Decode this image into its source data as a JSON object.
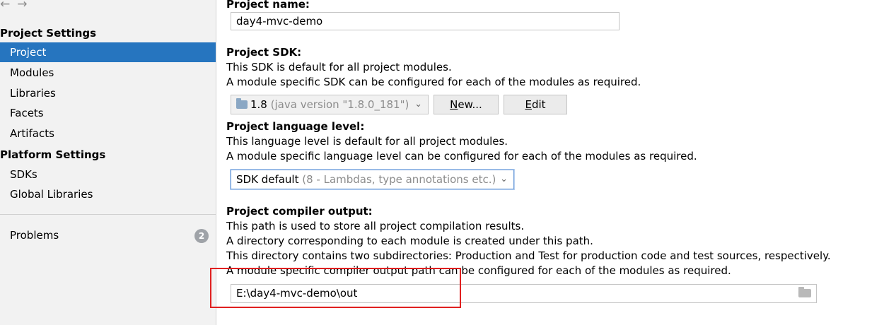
{
  "nav": {
    "back_icon": "←",
    "forward_icon": "→"
  },
  "sidebar": {
    "project_settings_header": "Project Settings",
    "project_items": [
      "Project",
      "Modules",
      "Libraries",
      "Facets",
      "Artifacts"
    ],
    "platform_settings_header": "Platform Settings",
    "platform_items": [
      "SDKs",
      "Global Libraries"
    ],
    "problems_label": "Problems",
    "problems_count": "2",
    "selected": "Project"
  },
  "main": {
    "project_name": {
      "label": "Project name:",
      "value": "day4-mvc-demo"
    },
    "project_sdk": {
      "label": "Project SDK:",
      "desc1": "This SDK is default for all project modules.",
      "desc2": "A module specific SDK can be configured for each of the modules as required.",
      "selected_version": "1.8",
      "selected_detail": "(java version \"1.8.0_181\")",
      "new_button": "New...",
      "edit_button": "Edit"
    },
    "language_level": {
      "label": "Project language level:",
      "desc1": "This language level is default for all project modules.",
      "desc2": "A module specific language level can be configured for each of the modules as required.",
      "selected_main": "SDK default",
      "selected_detail": "(8 - Lambdas, type annotations etc.)"
    },
    "compiler_output": {
      "label": "Project compiler output:",
      "desc1": "This path is used to store all project compilation results.",
      "desc2": "A directory corresponding to each module is created under this path.",
      "desc3": "This directory contains two subdirectories: Production and Test for production code and test sources, respectively.",
      "desc4": "A module specific compiler output path can be configured for each of the modules as required.",
      "path": "E:\\day4-mvc-demo\\out"
    }
  },
  "colors": {
    "selection": "#2675bf",
    "annotation": "#e02020"
  }
}
